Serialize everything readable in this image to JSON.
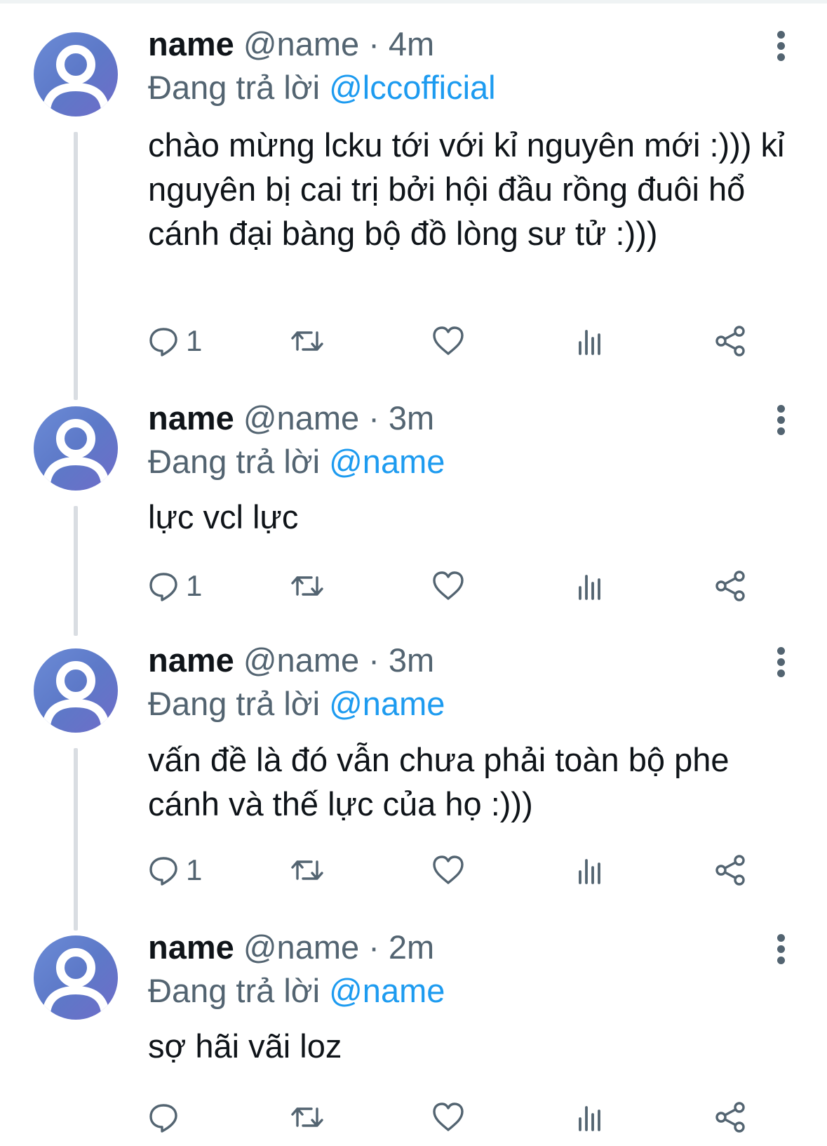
{
  "tweets": [
    {
      "name": "name",
      "handle": "@name",
      "separator": "·",
      "time": "4m",
      "reply_prefix": "Đang trả lời",
      "reply_to": "@lccofficial",
      "text": "chào mừng lcku tới với kỉ nguyên mới :))) kỉ nguyên bị cai trị bởi hội đầu rồng đuôi hổ cánh đại bàng bộ đồ lòng sư tử :)))",
      "reply_count": "1"
    },
    {
      "name": "name",
      "handle": "@name",
      "separator": "·",
      "time": "3m",
      "reply_prefix": "Đang trả lời",
      "reply_to": "@name",
      "text": "lực vcl lực",
      "reply_count": "1"
    },
    {
      "name": "name",
      "handle": "@name",
      "separator": "·",
      "time": "3m",
      "reply_prefix": "Đang trả lời",
      "reply_to": "@name",
      "text": "vấn đề là đó vẫn chưa phải toàn bộ phe cánh và thế lực của họ :)))",
      "reply_count": "1"
    },
    {
      "name": "name",
      "handle": "@name",
      "separator": "·",
      "time": "2m",
      "reply_prefix": "Đang trả lời",
      "reply_to": "@name",
      "text": "sợ hãi vãi loz",
      "reply_count": ""
    }
  ],
  "icons": {
    "reply": "reply-icon",
    "retweet": "retweet-icon",
    "like": "heart-icon",
    "views": "views-icon",
    "share": "share-icon",
    "more": "more-vertical-icon",
    "avatar": "default-avatar-icon"
  },
  "colors": {
    "text": "#0f1419",
    "secondary": "#536471",
    "mention": "#1d9bf0",
    "thread_line": "#d9dde2",
    "avatar": "#6b8bd6"
  }
}
